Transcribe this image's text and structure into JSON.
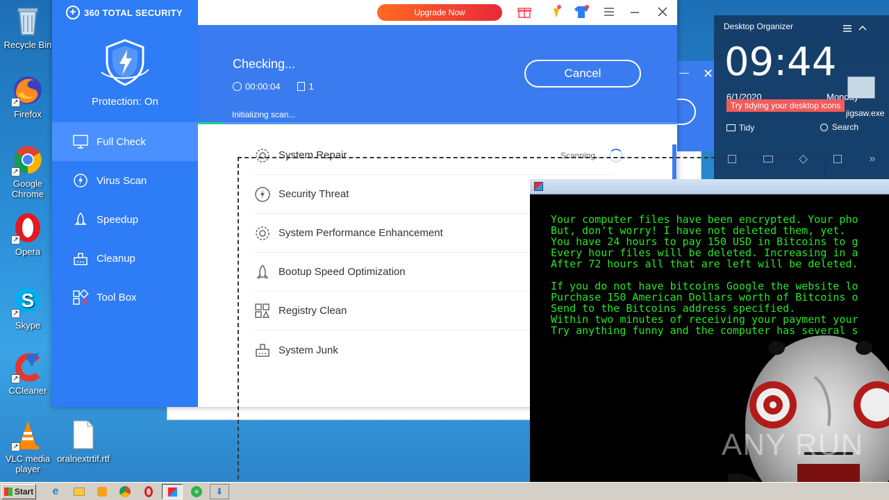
{
  "desktop": {
    "icons": [
      {
        "label": "Recycle Bin"
      },
      {
        "label": "Firefox"
      },
      {
        "label": "Google Chrome"
      },
      {
        "label": "Opera"
      },
      {
        "label": "Skype"
      },
      {
        "label": "CCleaner"
      },
      {
        "label": "VLC media player"
      },
      {
        "label": "oralnextrtif.rtf"
      }
    ]
  },
  "security360": {
    "brand": "360 TOTAL SECURITY",
    "upgrade_label": "Upgrade Now",
    "protection_status": "Protection: On",
    "nav": [
      {
        "label": "Full Check",
        "icon": "monitor-icon",
        "active": true
      },
      {
        "label": "Virus Scan",
        "icon": "lightning-icon",
        "active": false
      },
      {
        "label": "Speedup",
        "icon": "rocket-icon",
        "active": false
      },
      {
        "label": "Cleanup",
        "icon": "broom-icon",
        "active": false
      },
      {
        "label": "Tool Box",
        "icon": "toolbox-icon",
        "active": false
      }
    ],
    "status_title": "Checking...",
    "elapsed_time": "00:00:04",
    "item_count": "1",
    "cancel_label": "Cancel",
    "scan_status": "Initializing scan...",
    "progress": 0.05,
    "checks": [
      {
        "label": "System Repair",
        "icon": "gear-icon",
        "status": "Scanning..."
      },
      {
        "label": "Security Threat",
        "icon": "lightning-circle-icon",
        "status": ""
      },
      {
        "label": "System Performance Enhancement",
        "icon": "gear-icon",
        "status": ""
      },
      {
        "label": "Bootup Speed Optimization",
        "icon": "rocket-icon",
        "status": ""
      },
      {
        "label": "Registry Clean",
        "icon": "registry-icon",
        "status": ""
      },
      {
        "label": "System Junk",
        "icon": "broom-icon",
        "status": ""
      }
    ]
  },
  "jigsaw": {
    "message_lines": [
      "Your computer files have been encrypted. Your pho",
      "But, don't worry! I have not deleted them, yet.",
      "You have 24 hours to pay 150 USD in Bitcoins to g",
      "Every hour files will be deleted. Increasing in a",
      "After 72 hours all that are left will be deleted.",
      "",
      "If you do not have bitcoins Google the website lo",
      "Purchase 150 American Dollars worth of Bitcoins o",
      "Send to the Bitcoins address specified.",
      "Within two minutes of receiving your payment your",
      "Try anything funny and the computer has several s"
    ],
    "watermark": "ANY RUN"
  },
  "organizer": {
    "title": "Desktop Organizer",
    "time": "09:44",
    "date": "6/1/2020",
    "day": "Monday",
    "tooltip": "Try tidying your desktop icons",
    "file_label": "jigsaw.exe",
    "tidy_label": "Tidy",
    "search_label": "Search"
  },
  "taskbar": {
    "start_label": "Start"
  },
  "colors": {
    "brand_blue": "#2e7cf6",
    "accent_red": "#e8293a",
    "terminal_green": "#25e825"
  }
}
